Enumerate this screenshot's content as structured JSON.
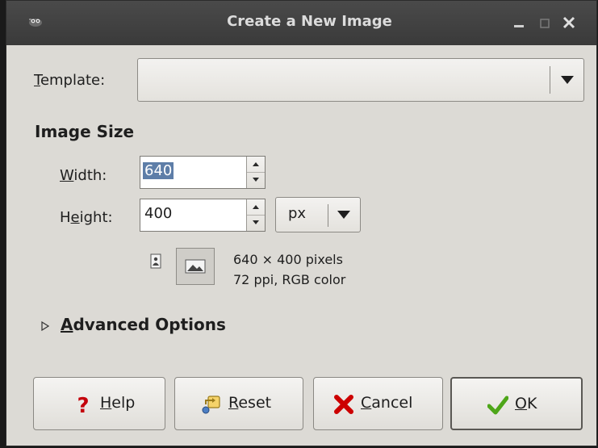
{
  "window": {
    "title": "Create a New Image",
    "minimize_glyph": "▁",
    "maximize_glyph": "□",
    "close_glyph": "✕"
  },
  "template": {
    "label_mnemonic": "T",
    "label_rest": "emplate:",
    "value": ""
  },
  "image_size": {
    "title": "Image Size",
    "width_label_mnemonic": "W",
    "width_label_rest": "idth:",
    "width_value": "640",
    "height_label_pre": "H",
    "height_label_mnemonic": "e",
    "height_label_rest": "ight:",
    "height_value": "400",
    "unit": "px",
    "info_pixels": "640 × 400 pixels",
    "info_meta": "72 ppi, RGB color"
  },
  "advanced": {
    "label_mnemonic": "A",
    "label_rest": "dvanced Options",
    "expanded": false
  },
  "buttons": {
    "help_mnemonic": "H",
    "help_rest": "elp",
    "reset_mnemonic": "R",
    "reset_rest": "eset",
    "cancel_mnemonic": "C",
    "cancel_rest": "ancel",
    "ok_mnemonic": "O",
    "ok_rest": "K"
  },
  "icons": {
    "title": "gimp-wilber-icon",
    "help": "question-mark-icon",
    "reset": "reset-icon",
    "cancel": "cancel-x-icon",
    "ok": "checkmark-icon",
    "portrait": "portrait-orientation-icon",
    "landscape": "landscape-orientation-icon"
  },
  "colors": {
    "help_red": "#c4000b",
    "cancel_red": "#cc0000",
    "ok_green": "#4ea619",
    "selection": "#5e7ea8"
  }
}
